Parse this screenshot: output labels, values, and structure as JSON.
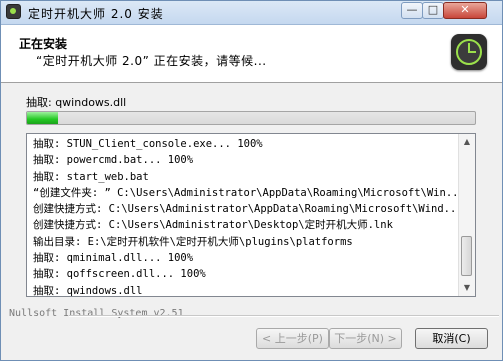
{
  "window": {
    "title": "定时开机大师 2.0 安装"
  },
  "titlebar": {
    "min": "—",
    "max": "□",
    "close": "✕"
  },
  "header": {
    "title": "正在安装",
    "subtitle": "“定时开机大师 2.0” 正在安装，请等候..."
  },
  "status": {
    "text": "抽取: qwindows.dll"
  },
  "progress": {
    "fraction": 0.07
  },
  "log": {
    "lines": [
      "抽取: STUN_Client_console.exe... 100%",
      "抽取: powercmd.bat... 100%",
      "抽取: start_web.bat",
      "“创建文件夹: ” C:\\Users\\Administrator\\AppData\\Roaming\\Microsoft\\Win...",
      "创建快捷方式: C:\\Users\\Administrator\\AppData\\Roaming\\Microsoft\\Wind...",
      "创建快捷方式: C:\\Users\\Administrator\\Desktop\\定时开机大师.lnk",
      "输出目录: E:\\定时开机软件\\定时开机大师\\plugins\\platforms",
      "抽取: qminimal.dll... 100%",
      "抽取: qoffscreen.dll... 100%",
      "抽取: qwindows.dll"
    ]
  },
  "footer": {
    "brand": "Nullsoft Install System v2.51"
  },
  "buttons": {
    "back": "< 上一步(P)",
    "next": "下一步(N) >",
    "cancel": "取消(C)"
  }
}
